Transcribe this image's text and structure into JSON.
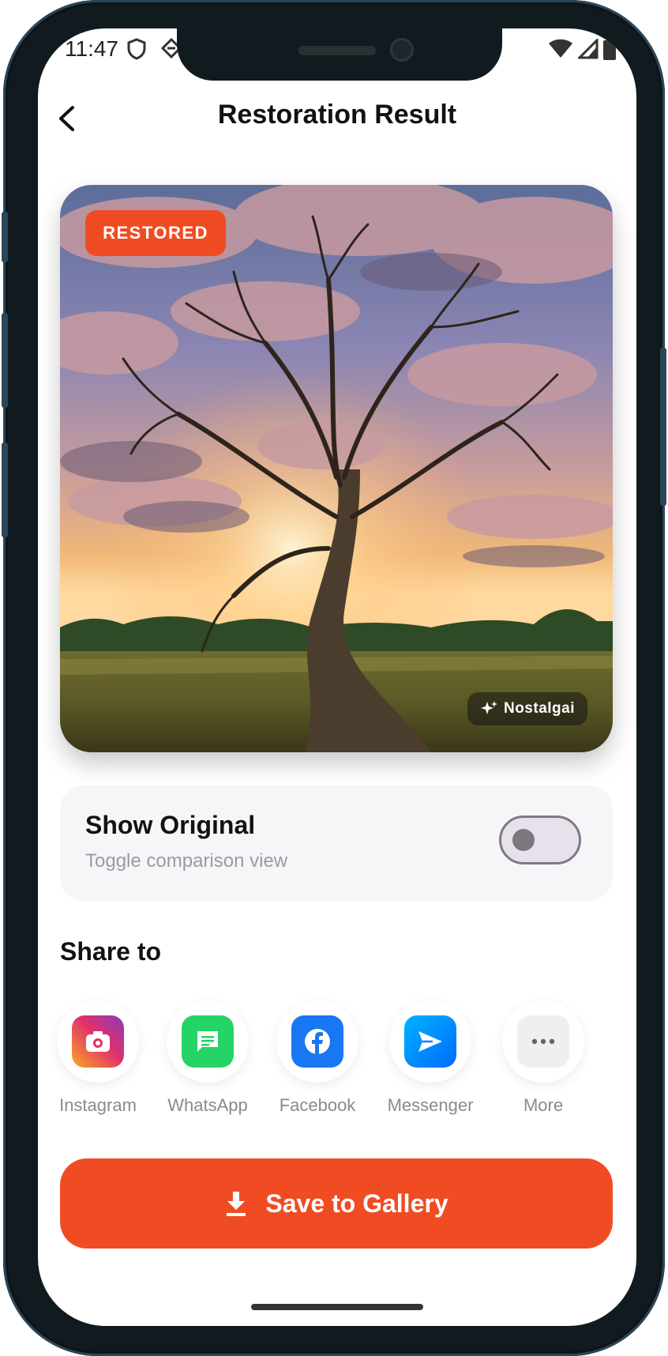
{
  "status_bar": {
    "time": "11:47"
  },
  "header": {
    "title": "Restoration Result"
  },
  "photo": {
    "badge": "RESTORED",
    "brand": "Nostalgai"
  },
  "compare": {
    "title": "Show Original",
    "subtitle": "Toggle comparison view",
    "enabled": false
  },
  "share": {
    "heading": "Share to",
    "items": [
      {
        "label": "Instagram",
        "icon": "instagram-icon",
        "color": "#e1306c"
      },
      {
        "label": "WhatsApp",
        "icon": "whatsapp-icon",
        "color": "#25d366"
      },
      {
        "label": "Facebook",
        "icon": "facebook-icon",
        "color": "#1877f2"
      },
      {
        "label": "Messenger",
        "icon": "messenger-icon",
        "color": "#0a7cff"
      },
      {
        "label": "More",
        "icon": "more-icon",
        "color": "#efefef"
      }
    ]
  },
  "actions": {
    "save_label": "Save to Gallery"
  },
  "colors": {
    "accent": "#f04c23",
    "card_bg": "#f6f6f9"
  }
}
